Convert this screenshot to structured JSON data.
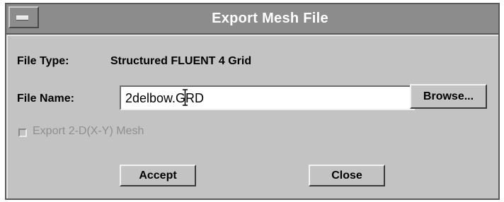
{
  "window": {
    "title": "Export Mesh File"
  },
  "form": {
    "file_type_label": "File Type:",
    "file_type_value": "Structured FLUENT 4 Grid",
    "file_name_label": "File Name:",
    "file_name_value": "2delbow.GRD",
    "browse_label": "Browse...",
    "export_checkbox_label": "Export 2-D(X-Y) Mesh",
    "export_checkbox_checked": false,
    "export_checkbox_enabled": false
  },
  "buttons": {
    "accept_label": "Accept",
    "close_label": "Close"
  }
}
